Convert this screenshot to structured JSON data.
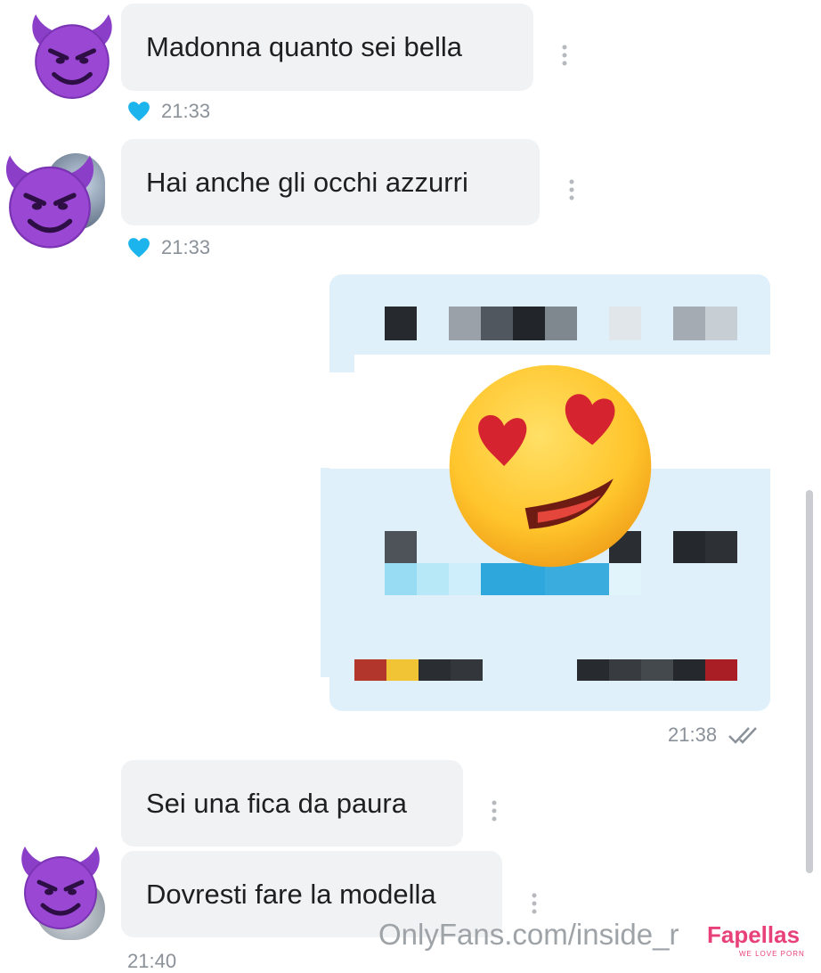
{
  "messages": [
    {
      "text": "Madonna quanto sei bella",
      "time": "21:33"
    },
    {
      "text": "Hai anche gli occhi azzurri",
      "time": "21:33"
    },
    {
      "text": "Sei una fica da paura"
    },
    {
      "text": "Dovresti fare la modella",
      "time": "21:40"
    }
  ],
  "outgoing": {
    "time": "21:38"
  },
  "icons": {
    "avatar": "smiling-devil-emoji",
    "like": "heart-icon",
    "read_receipt": "double-check-icon",
    "menu": "kebab-icon",
    "censor": "heart-eyes-emoji"
  },
  "colors": {
    "heart": "#1bb4ec",
    "bubble_out": "#dff0fb",
    "bubble_in": "#f1f2f4"
  },
  "watermark": {
    "text": "OnlyFans.com/inside_r",
    "brand": "Fapellas",
    "brand_sub": "WE LOVE PORN"
  }
}
